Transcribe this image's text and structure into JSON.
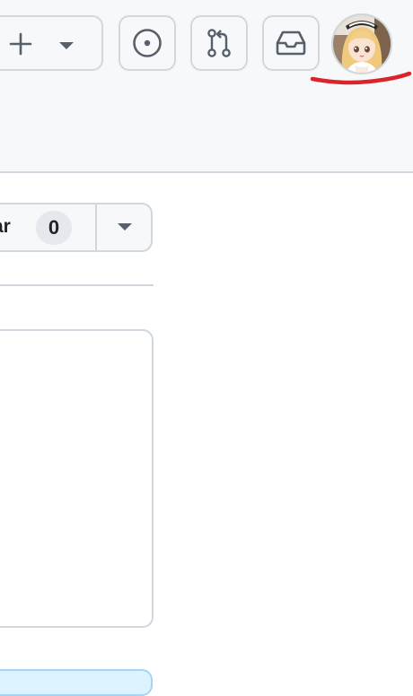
{
  "header": {
    "create_button": {
      "plus_icon": "plus-icon",
      "caret_icon": "triangle-down-icon"
    },
    "issues_button": {
      "icon": "issue-opened-icon"
    },
    "pulls_button": {
      "icon": "git-pull-request-icon"
    },
    "inbox_button": {
      "icon": "inbox-icon"
    },
    "avatar": {
      "icon": "user-avatar-anime-girl"
    },
    "annotation_color": "#d9252a"
  },
  "repo": {
    "star_button": {
      "label": "tar",
      "count": "0",
      "dropdown_icon": "triangle-down-icon"
    }
  },
  "colors": {
    "header_background": "#f6f8fa",
    "border": "#d0d7de",
    "text": "#1f2328",
    "counter_background": "#e5e8ec",
    "bottom_box_background": "#ddf4ff"
  }
}
